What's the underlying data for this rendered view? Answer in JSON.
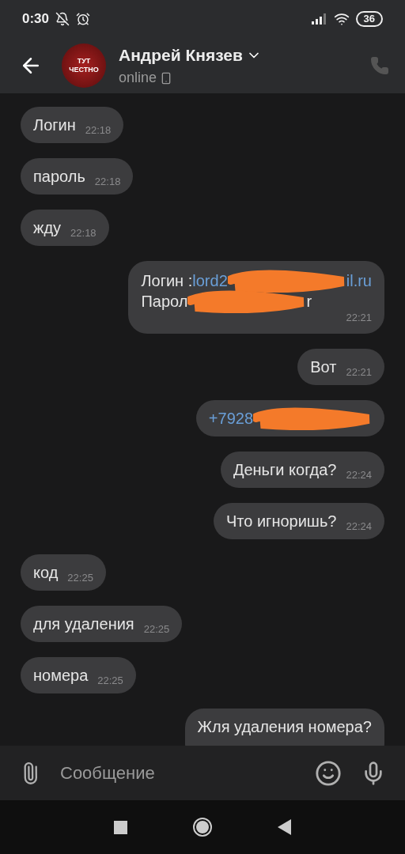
{
  "status_bar": {
    "time": "0:30",
    "battery": "36"
  },
  "header": {
    "avatar_lines": [
      "ТУТ",
      "ЧЕСТНО"
    ],
    "name": "Андрей Князев",
    "presence": "online"
  },
  "messages": [
    {
      "outgoing": false,
      "lines": [
        [
          {
            "text": "Логин"
          }
        ]
      ],
      "time": "22:18"
    },
    {
      "outgoing": false,
      "lines": [
        [
          {
            "text": "пароль"
          }
        ]
      ],
      "time": "22:18"
    },
    {
      "outgoing": false,
      "lines": [
        [
          {
            "text": "жду"
          }
        ]
      ],
      "time": "22:18"
    },
    {
      "outgoing": true,
      "lines": [
        [
          {
            "text": "Логин :"
          },
          {
            "text": "lord2",
            "kind": "link"
          },
          {
            "kind": "redacted"
          },
          {
            "text": "il.ru",
            "kind": "link"
          }
        ],
        [
          {
            "text": "Парол"
          },
          {
            "kind": "redacted"
          },
          {
            "text": "r"
          }
        ]
      ],
      "time": "22:21"
    },
    {
      "outgoing": true,
      "lines": [
        [
          {
            "text": "Вот"
          }
        ]
      ],
      "time": "22:21"
    },
    {
      "outgoing": true,
      "lines": [
        [
          {
            "text": "+7928",
            "kind": "link"
          },
          {
            "kind": "redacted"
          }
        ]
      ]
    },
    {
      "outgoing": true,
      "lines": [
        [
          {
            "text": "Деньги когда?"
          }
        ]
      ],
      "time": "22:24"
    },
    {
      "outgoing": true,
      "lines": [
        [
          {
            "text": "Что игноришь?"
          }
        ]
      ],
      "time": "22:24"
    },
    {
      "outgoing": false,
      "lines": [
        [
          {
            "text": "код"
          }
        ]
      ],
      "time": "22:25"
    },
    {
      "outgoing": false,
      "lines": [
        [
          {
            "text": "для удаления"
          }
        ]
      ],
      "time": "22:25"
    },
    {
      "outgoing": false,
      "lines": [
        [
          {
            "text": "номера"
          }
        ]
      ],
      "time": "22:25"
    },
    {
      "outgoing": true,
      "lines": [
        [
          {
            "text": "Жля удаления номера?"
          }
        ]
      ]
    }
  ],
  "composer": {
    "placeholder": "Сообщение"
  }
}
